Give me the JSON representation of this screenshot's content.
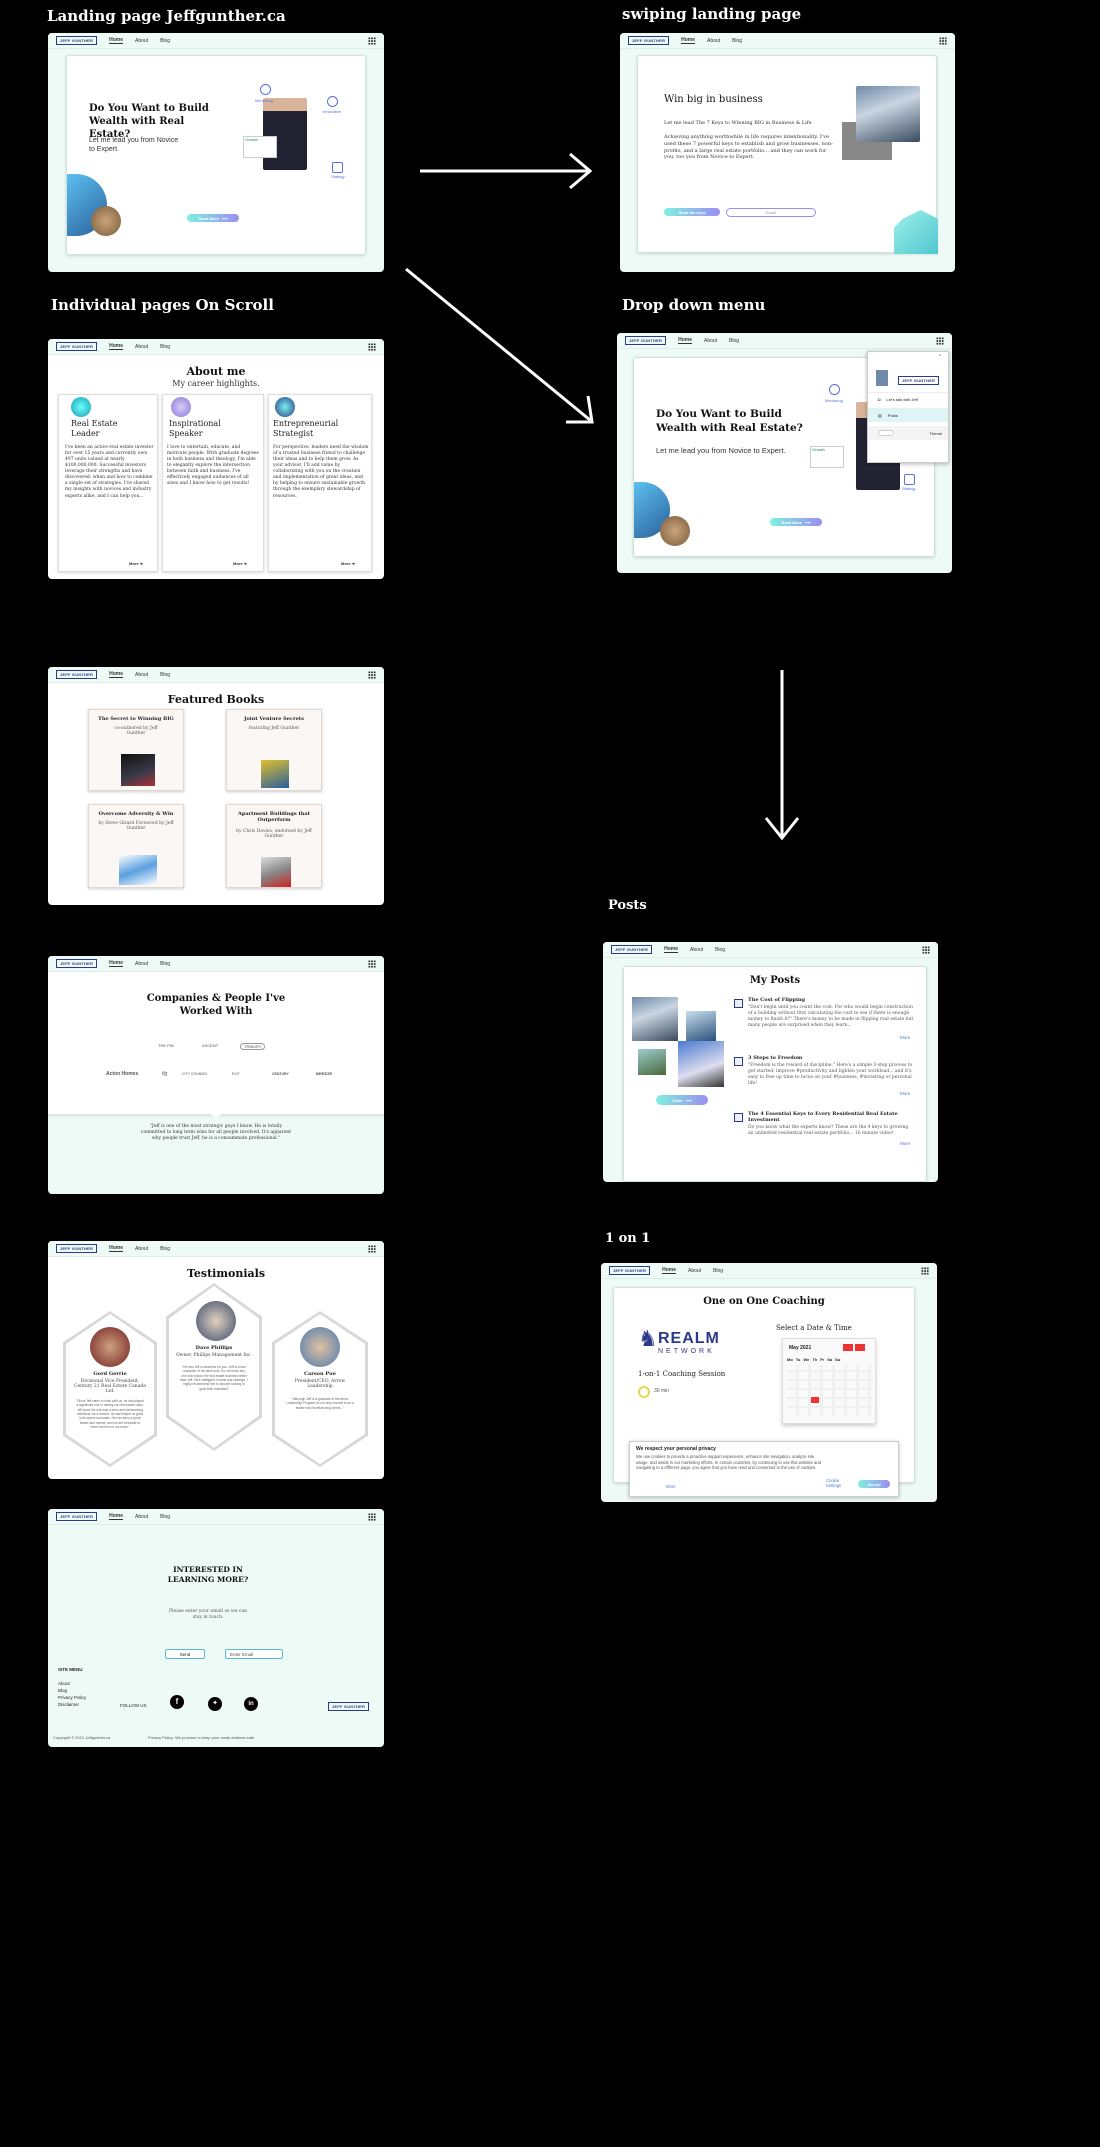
{
  "labels": {
    "landing": "Landing page  Jeffgunther.ca",
    "swiping": "swiping landing page",
    "individual": "Individual pages On Scroll",
    "dropdown": "Drop down menu",
    "posts": "Posts",
    "oneonone": "1 on 1"
  },
  "nav": {
    "logo": "JEFF GUNTHER",
    "home": "Home",
    "about": "About",
    "blog": "Blog"
  },
  "landing": {
    "headline": "Do You Want to Build Wealth with Real Estate?",
    "sub": "Let me lead you from Novice to Expert.",
    "button": "Read More",
    "mentoring": "Mentoring",
    "innovative": "Innovative",
    "growth": "Growth",
    "stategy": "Stategy"
  },
  "swipe": {
    "headline": "Win big in business",
    "lead": "Let me lead The 7 Keys to Winning BIG in Business & Life",
    "body": "Achieving anything worthwhile in life requires intentionality. I've used these 7 powerful keys to establish and grow businesses, non-profits, and a large real estate portfolio... and they can work for you, too you from Novice to Expert.",
    "button": "Read the keys",
    "email_placeholder": "Email"
  },
  "dropdown": {
    "item1": "Let's talk with Jeff",
    "item2": "Posts",
    "item3": "Theme"
  },
  "about": {
    "title": "About me",
    "subtitle": "My career highlights.",
    "cards": [
      {
        "title": "Real Estate Leader",
        "body": "I've been an active real estate investor for over 15 years and currently own 497 units valued at nearly $100,000,000. Successful investors leverage their strengths and have discovered: when and how to combine a single set of strategies. I've shared my insights with novices and industry experts alike, and I can help you...",
        "more": "More"
      },
      {
        "title": "Inspirational Speaker",
        "body": "I love to entertain, educate, and motivate people. With graduate degrees in both business and theology, I'm able to elegantly explore the intersection between faith and business. I've effectively engaged audiences of all sizes and I know how to get results!",
        "more": "More"
      },
      {
        "title": "Entrepreneurial Strategist",
        "body": "For perspective, leaders need the wisdom of a trusted business friend to challenge their ideas and to help them grow. As your advisor, I'll add value by collaborating with you on the creation and implementation of great ideas, and by helping to ensure sustainable growth through the exemplary stewardship of resources.",
        "more": "More"
      }
    ]
  },
  "books": {
    "title": "Featured Books",
    "items": [
      {
        "title": "The Secret to Winning BIG",
        "sub": "co-authored by Jeff Gunther"
      },
      {
        "title": "Joint Venture Secrets",
        "sub": "featuring Jeff Gunther"
      },
      {
        "title": "Overcome Adversity & Win",
        "sub": "by Steve Girard Foreword by Jeff Gunther"
      },
      {
        "title": "Apartment Buildings that Outperform",
        "sub": "by Chris Davies, endorsed by Jeff Gunther"
      }
    ]
  },
  "companies": {
    "title": "Companies & People I've Worked With",
    "row1": [
      "THE PIN",
      "ASCENT",
      "TRIBURY"
    ],
    "row2": [
      "Acton Homes",
      "fig",
      "CITY COUNSEL",
      "CENTURY",
      "EXIT",
      "BREEZE"
    ],
    "quote": "\"Jeff is one of the most strategic guys I know. He is totally committed to long term wins for all people involved. It's apparent why people trust Jeff, he is a consummate professional.\""
  },
  "testimonials": {
    "title": "Testimonials",
    "people": [
      {
        "name": "Gord Gerrie",
        "role": "Divisional Vice President, Century 21 Real Estate Canada Ltd.",
        "quote": "\"Since Jeff came to work with us, he had played a significant role in raising our real estate sales. Jeff knew his role was a keen and hardworking individual. As a mentor, he had helped us grow both teams and sales. He has been a great leader and mentor, and we are fortunate to have had him on our team.\""
      },
      {
        "name": "Dave Phillips",
        "role": "Owner, Phillips Management Inc.",
        "quote": "\"He and Jeff in business for you. Jeff is a true character of his best work. Do not know any one who knows the real estate business better than Jeff. He's intelligent, honest and strategic. I highly recommend him to anyone looking to grow their business!\""
      },
      {
        "name": "Carson Pue",
        "role": "President/CEO, Arrow Leadership",
        "quote": "\"Although Jeff is a graduate of the Arrow Leadership Program he not only learned to be a leader who is influencing others...\""
      }
    ]
  },
  "subscribe": {
    "title": "INTERESTED IN LEARNING MORE?",
    "sub": "Please enter your email so we can stay in touch.",
    "send": "Send",
    "email_placeholder": "Enter Email",
    "site_menu": "SITE MENU",
    "menu": [
      "About",
      "Blog",
      "Privacy Policy",
      "Disclaimer"
    ],
    "follow": "FOLLOW US",
    "copyright": "Copyright © 2021 Jeffgunther.ca",
    "privacy": "Privacy Policy: We promise to keep your email address safe"
  },
  "posts": {
    "title": "My Posts",
    "older": "Older",
    "items": [
      {
        "title": "The Cost of Flipping",
        "body": "\"Don't begin until you count the cost. For who would begin construction of a building without first calculating the cost to see if there is enough money to finish it?\" There's money to be made in flipping real estate but many people are surprised when they learn...",
        "more": "More"
      },
      {
        "title": "3 Steps to Freedom",
        "body": "\"Freedom is the reward of discipline.\" Here's a simple 3-step process to get started; improve #productivity and lighten your workload... and it's easy to free up time to focus on your #business, #investing or personal life!",
        "more": "More"
      },
      {
        "title": "The 4 Essential Keys to Every Residential Real Estate Investment",
        "body": "Do you know what the experts know? These are the 4 keys to growing an unlimited residential real estate portfolio... 16 minute video!",
        "more": "More"
      }
    ]
  },
  "coaching": {
    "title": "One on One Coaching",
    "brand": "REALM",
    "brand_sub": "NETWORK",
    "session": "1-on-1 Coaching Session",
    "duration": "30 min",
    "select": "Select a Date & Time",
    "month": "May 2021",
    "days": [
      "Mo",
      "Tu",
      "We",
      "Th",
      "Fr",
      "Sa",
      "Su"
    ],
    "cookie_title": "We respect your personal privacy",
    "cookie_body": "We use cookies to provide a proactive support experience, enhance site navigation, analyze site usage, and assist in our marketing efforts. In certain countries, by continuing to use this website and navigating to a different page, you agree that you have read and consented to the use of cookies.",
    "cookie_more": "More",
    "cookie_settings": "Cookie Settings",
    "accept": "Accept"
  }
}
